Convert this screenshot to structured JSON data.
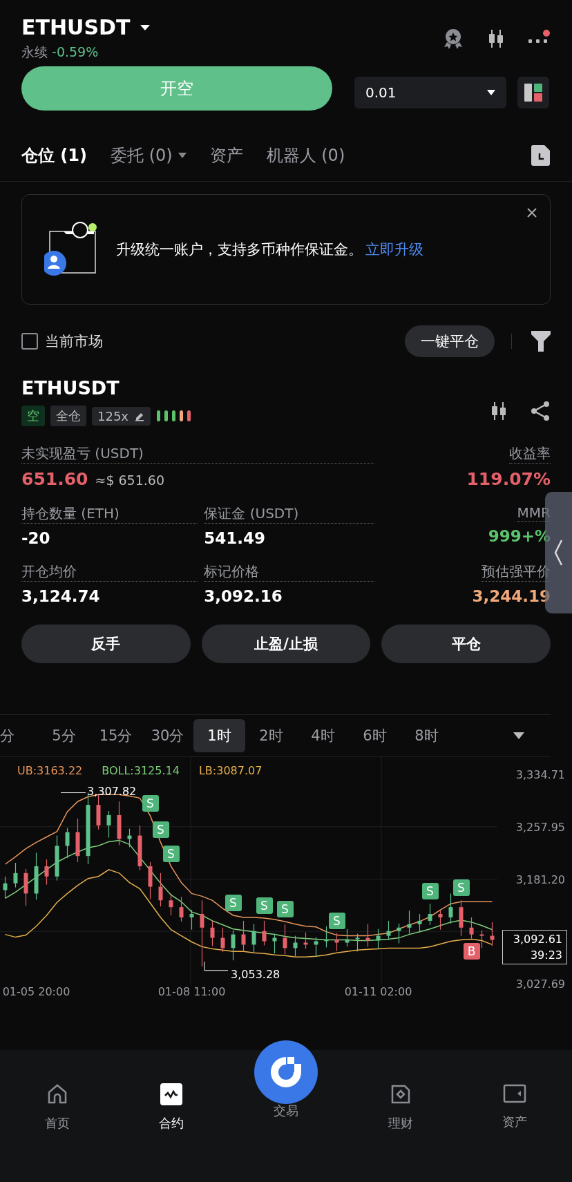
{
  "header": {
    "symbol": "ETHUSDT",
    "type": "永续",
    "change": "-0.59%",
    "has_notification": true
  },
  "order": {
    "button": "开空",
    "amount": "0.01"
  },
  "tabs": [
    {
      "label": "仓位 (1)",
      "selected": true,
      "dropdown": false
    },
    {
      "label": "委托 (0)",
      "selected": false,
      "dropdown": true
    },
    {
      "label": "资产",
      "selected": false,
      "dropdown": false
    },
    {
      "label": "机器人 (0)",
      "selected": false,
      "dropdown": false
    }
  ],
  "banner": {
    "text": "升级统一账户，支持多币种作保证金。",
    "link": "立即升级"
  },
  "filter": {
    "label": "当前市场",
    "checked": false,
    "close_all": "一键平仓"
  },
  "position": {
    "symbol": "ETHUSDT",
    "side": "空",
    "margin_mode": "全仓",
    "leverage": "125x",
    "stats": [
      {
        "label": "未实现盈亏 (USDT)",
        "value": "651.60",
        "approx": "≈$ 651.60",
        "color": "#e5616a"
      },
      {
        "label": "收益率",
        "value": "119.07%",
        "color": "#e5616a"
      },
      {
        "label": "持仓数量 (ETH)",
        "value": "-20",
        "color": "#ffffff"
      },
      {
        "label": "保证金 (USDT)",
        "value": "541.49",
        "color": "#ffffff"
      },
      {
        "label": "MMR",
        "value": "999+%",
        "color": "#5cc26b"
      },
      {
        "label": "开仓均价",
        "value": "3,124.74",
        "color": "#ffffff"
      },
      {
        "label": "标记价格",
        "value": "3,092.16",
        "color": "#ffffff"
      },
      {
        "label": "预估强平价",
        "value": "3,244.19",
        "color": "#f0a87a"
      }
    ],
    "actions": [
      "反手",
      "止盈/止损",
      "平仓"
    ]
  },
  "timeframes": [
    {
      "label": "分",
      "selected": false
    },
    {
      "label": "5分",
      "selected": false
    },
    {
      "label": "15分",
      "selected": false
    },
    {
      "label": "30分",
      "selected": false
    },
    {
      "label": "1时",
      "selected": true
    },
    {
      "label": "2时",
      "selected": false
    },
    {
      "label": "4时",
      "selected": false
    },
    {
      "label": "6时",
      "selected": false
    },
    {
      "label": "8时",
      "selected": false
    }
  ],
  "chart": {
    "high": "3,307.82",
    "low": "3,053.28",
    "price": "3,092.61",
    "countdown": "39:23",
    "markers": [
      {
        "label": "S",
        "kind": "sell"
      },
      {
        "label": "S",
        "kind": "sell"
      },
      {
        "label": "S",
        "kind": "sell"
      },
      {
        "label": "S",
        "kind": "sell"
      },
      {
        "label": "S",
        "kind": "sell"
      },
      {
        "label": "S",
        "kind": "sell"
      },
      {
        "label": "S",
        "kind": "sell"
      },
      {
        "label": "S",
        "kind": "sell"
      },
      {
        "label": "S",
        "kind": "sell"
      },
      {
        "label": "B",
        "kind": "buy"
      }
    ],
    "chart_data": {
      "type": "candlestick",
      "categories": [
        null,
        null,
        null,
        "01-05 20:00",
        null,
        null,
        null,
        null,
        null,
        null,
        null,
        null,
        null,
        null,
        null,
        null,
        null,
        null,
        "01-08 11:00",
        null,
        null,
        null,
        null,
        null,
        null,
        null,
        null,
        null,
        null,
        null,
        null,
        null,
        null,
        null,
        null,
        null,
        "01-11 02:00",
        null,
        null,
        null,
        null,
        null,
        null,
        null,
        null,
        null,
        null,
        null
      ],
      "ohlc": [
        [
          3165,
          3185,
          3153,
          3175
        ],
        [
          3175,
          3205,
          3169,
          3190
        ],
        [
          3190,
          3196,
          3142,
          3160
        ],
        [
          3160,
          3220,
          3151,
          3200
        ],
        [
          3200,
          3210,
          3173,
          3185
        ],
        [
          3185,
          3245,
          3179,
          3230
        ],
        [
          3230,
          3256,
          3212,
          3250
        ],
        [
          3250,
          3270,
          3206,
          3215
        ],
        [
          3215,
          3308,
          3203,
          3290
        ],
        [
          3290,
          3305,
          3254,
          3260
        ],
        [
          3260,
          3281,
          3242,
          3275
        ],
        [
          3275,
          3295,
          3231,
          3240
        ],
        [
          3240,
          3255,
          3228,
          3245
        ],
        [
          3245,
          3260,
          3194,
          3200
        ],
        [
          3200,
          3206,
          3152,
          3170
        ],
        [
          3170,
          3190,
          3141,
          3150
        ],
        [
          3150,
          3160,
          3128,
          3140
        ],
        [
          3140,
          3155,
          3119,
          3125
        ],
        [
          3125,
          3136,
          3107,
          3130
        ],
        [
          3130,
          3150,
          3053,
          3110
        ],
        [
          3110,
          3120,
          3083,
          3095
        ],
        [
          3095,
          3110,
          3074,
          3080
        ],
        [
          3080,
          3106,
          3062,
          3100
        ],
        [
          3100,
          3120,
          3076,
          3085
        ],
        [
          3085,
          3115,
          3073,
          3105
        ],
        [
          3105,
          3120,
          3084,
          3090
        ],
        [
          3090,
          3101,
          3072,
          3095
        ],
        [
          3095,
          3115,
          3071,
          3080
        ],
        [
          3080,
          3098,
          3068,
          3088
        ],
        [
          3088,
          3103,
          3079,
          3085
        ],
        [
          3085,
          3096,
          3067,
          3090
        ],
        [
          3090,
          3112,
          3081,
          3092
        ],
        [
          3092,
          3102,
          3076,
          3088
        ],
        [
          3088,
          3108,
          3082,
          3093
        ],
        [
          3093,
          3101,
          3075,
          3095
        ],
        [
          3095,
          3115,
          3082,
          3091
        ],
        [
          3091,
          3108,
          3079,
          3098
        ],
        [
          3098,
          3120,
          3092,
          3105
        ],
        [
          3105,
          3116,
          3087,
          3110
        ],
        [
          3110,
          3135,
          3101,
          3115
        ],
        [
          3115,
          3130,
          3103,
          3120
        ],
        [
          3120,
          3145,
          3114,
          3130
        ],
        [
          3130,
          3136,
          3107,
          3125
        ],
        [
          3125,
          3160,
          3116,
          3140
        ],
        [
          3140,
          3150,
          3098,
          3110
        ],
        [
          3110,
          3125,
          3094,
          3100
        ],
        [
          3100,
          3106,
          3080,
          3098
        ],
        [
          3098,
          3118,
          3083,
          3092
        ]
      ],
      "series": [
        {
          "name": "UB:3163.22",
          "type": "line",
          "color": "#e8955a",
          "values": [
            3203,
            3214,
            3226,
            3235,
            3243,
            3251,
            3280,
            3295,
            3302,
            3305,
            3305,
            3305,
            3303,
            3300,
            3274,
            3235,
            3200,
            3176,
            3160,
            3156,
            3150,
            3138,
            3128,
            3125,
            3125,
            3124,
            3122,
            3119,
            3115,
            3112,
            3111,
            3104,
            3099,
            3098,
            3098,
            3098,
            3100,
            3102,
            3108,
            3114,
            3119,
            3126,
            3136,
            3145,
            3148,
            3148,
            3148,
            3148
          ]
        },
        {
          "name": "BOLL:3125.14",
          "type": "line",
          "color": "#7ed07a",
          "values": [
            3153,
            3162,
            3173,
            3184,
            3195,
            3206,
            3214,
            3221,
            3227,
            3230,
            3236,
            3238,
            3232,
            3213,
            3194,
            3175,
            3158,
            3148,
            3133,
            3128,
            3120,
            3114,
            3108,
            3106,
            3104,
            3102,
            3100,
            3097,
            3095,
            3094,
            3093,
            3092,
            3092,
            3092,
            3091,
            3091,
            3092,
            3093,
            3095,
            3100,
            3104,
            3108,
            3113,
            3118,
            3121,
            3118,
            3113,
            3107
          ]
        },
        {
          "name": "LB:3087.07",
          "type": "line",
          "color": "#e8b04a",
          "values": [
            3100,
            3096,
            3099,
            3112,
            3128,
            3147,
            3160,
            3172,
            3182,
            3185,
            3195,
            3190,
            3176,
            3167,
            3146,
            3125,
            3107,
            3098,
            3089,
            3082,
            3079,
            3077,
            3075,
            3075,
            3073,
            3072,
            3070,
            3069,
            3067,
            3067,
            3068,
            3070,
            3073,
            3075,
            3077,
            3078,
            3079,
            3080,
            3080,
            3080,
            3080,
            3082,
            3086,
            3090,
            3092,
            3093,
            3091,
            3085
          ]
        }
      ],
      "ylim": [
        3027.69,
        3334.71
      ],
      "grid": true,
      "yticks": [
        {
          "value": 3334.71,
          "label": "3,334.71"
        },
        {
          "value": 3257.95,
          "label": "3,257.95"
        },
        {
          "value": 3181.2,
          "label": "3,181.20"
        },
        {
          "value": 3027.69,
          "label": "3,027.69"
        }
      ]
    }
  },
  "nav": [
    {
      "label": "首页",
      "selected": false,
      "kind": "home"
    },
    {
      "label": "合约",
      "selected": true,
      "kind": "futures"
    },
    {
      "label": "交易",
      "selected": false,
      "kind": "trade"
    },
    {
      "label": "理财",
      "selected": false,
      "kind": "earn"
    },
    {
      "label": "资产",
      "selected": false,
      "kind": "wallet"
    }
  ]
}
